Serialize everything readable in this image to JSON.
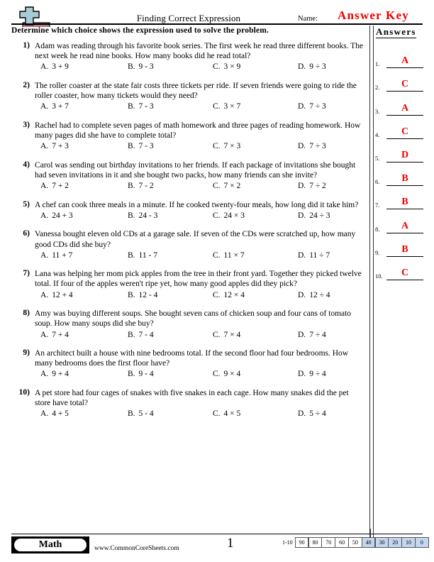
{
  "header": {
    "logo_icon": "plus-block-logo",
    "title": "Finding Correct Expression",
    "name_label": "Name:",
    "answer_key_label": "Answer Key",
    "instructions": "Determine which choice shows the expression used to solve the problem."
  },
  "answers_panel": {
    "heading": "Answers",
    "rows": [
      {
        "num": "1.",
        "value": "A"
      },
      {
        "num": "2.",
        "value": "C"
      },
      {
        "num": "3.",
        "value": "A"
      },
      {
        "num": "4.",
        "value": "C"
      },
      {
        "num": "5.",
        "value": "D"
      },
      {
        "num": "6.",
        "value": "B"
      },
      {
        "num": "7.",
        "value": "B"
      },
      {
        "num": "8.",
        "value": "A"
      },
      {
        "num": "9.",
        "value": "B"
      },
      {
        "num": "10.",
        "value": "C"
      }
    ],
    "answer_color": "#ee0000"
  },
  "questions": [
    {
      "num": "1)",
      "text": "Adam was reading through his favorite book series. The first week he read three different books. The next week he read nine books. How many books did he read total?",
      "options": [
        {
          "letter": "A.",
          "expr": "3 + 9"
        },
        {
          "letter": "B.",
          "expr": "9 - 3"
        },
        {
          "letter": "C.",
          "expr": "3 × 9"
        },
        {
          "letter": "D.",
          "expr": "9 ÷ 3"
        }
      ]
    },
    {
      "num": "2)",
      "text": "The roller coaster at the state fair costs three tickets per ride. If seven friends were going to ride the roller coaster, how many tickets would they need?",
      "options": [
        {
          "letter": "A.",
          "expr": "3 + 7"
        },
        {
          "letter": "B.",
          "expr": "7 - 3"
        },
        {
          "letter": "C.",
          "expr": "3 × 7"
        },
        {
          "letter": "D.",
          "expr": "7 ÷ 3"
        }
      ]
    },
    {
      "num": "3)",
      "text": "Rachel had to complete seven pages of math homework and three pages of reading homework. How many pages did she have to complete total?",
      "options": [
        {
          "letter": "A.",
          "expr": "7 + 3"
        },
        {
          "letter": "B.",
          "expr": "7 - 3"
        },
        {
          "letter": "C.",
          "expr": "7 × 3"
        },
        {
          "letter": "D.",
          "expr": "7 ÷ 3"
        }
      ]
    },
    {
      "num": "4)",
      "text": "Carol was sending out birthday invitations to her friends. If each package of invitations she bought had seven invitations in it and she bought two packs, how many friends can she invite?",
      "options": [
        {
          "letter": "A.",
          "expr": "7 + 2"
        },
        {
          "letter": "B.",
          "expr": "7 - 2"
        },
        {
          "letter": "C.",
          "expr": "7 × 2"
        },
        {
          "letter": "D.",
          "expr": "7 ÷ 2"
        }
      ]
    },
    {
      "num": "5)",
      "text": "A chef can cook three meals in a minute. If he cooked twenty-four meals, how long did it take him?",
      "options": [
        {
          "letter": "A.",
          "expr": "24 + 3"
        },
        {
          "letter": "B.",
          "expr": "24 - 3"
        },
        {
          "letter": "C.",
          "expr": "24 × 3"
        },
        {
          "letter": "D.",
          "expr": "24 ÷ 3"
        }
      ]
    },
    {
      "num": "6)",
      "text": "Vanessa bought eleven old CDs at a garage sale. If seven of the CDs were scratched up, how many good CDs did she buy?",
      "options": [
        {
          "letter": "A.",
          "expr": "11 + 7"
        },
        {
          "letter": "B.",
          "expr": "11 - 7"
        },
        {
          "letter": "C.",
          "expr": "11 × 7"
        },
        {
          "letter": "D.",
          "expr": "11 ÷ 7"
        }
      ]
    },
    {
      "num": "7)",
      "text": "Lana was helping her mom pick apples from the tree in their front yard. Together they picked twelve total. If four of the apples weren't ripe yet, how many good apples did they pick?",
      "options": [
        {
          "letter": "A.",
          "expr": "12 + 4"
        },
        {
          "letter": "B.",
          "expr": "12 - 4"
        },
        {
          "letter": "C.",
          "expr": "12 × 4"
        },
        {
          "letter": "D.",
          "expr": "12 ÷ 4"
        }
      ]
    },
    {
      "num": "8)",
      "text": "Amy was buying different soups. She bought seven cans of chicken soup and four cans of tomato soup. How many soups did she buy?",
      "options": [
        {
          "letter": "A.",
          "expr": "7 + 4"
        },
        {
          "letter": "B.",
          "expr": "7 - 4"
        },
        {
          "letter": "C.",
          "expr": "7 × 4"
        },
        {
          "letter": "D.",
          "expr": "7 ÷ 4"
        }
      ]
    },
    {
      "num": "9)",
      "text": "An architect built a house with nine bedrooms total. If the second floor had four bedrooms. How many bedrooms does the first floor have?",
      "options": [
        {
          "letter": "A.",
          "expr": "9 + 4"
        },
        {
          "letter": "B.",
          "expr": "9 - 4"
        },
        {
          "letter": "C.",
          "expr": "9 × 4"
        },
        {
          "letter": "D.",
          "expr": "9 ÷ 4"
        }
      ]
    },
    {
      "num": "10)",
      "text": "A pet store had four cages of snakes with five snakes in each cage. How many snakes did the pet store have total?",
      "options": [
        {
          "letter": "A.",
          "expr": "4 + 5"
        },
        {
          "letter": "B.",
          "expr": "5 - 4"
        },
        {
          "letter": "C.",
          "expr": "4 × 5"
        },
        {
          "letter": "D.",
          "expr": "5 ÷ 4"
        }
      ]
    }
  ],
  "footer": {
    "subject_label": "Math",
    "site_url": "www.CommonCoreSheets.com",
    "page_number": "1",
    "scale_label": "1-10",
    "scale_cells": [
      {
        "value": "90",
        "highlighted": false
      },
      {
        "value": "80",
        "highlighted": false
      },
      {
        "value": "70",
        "highlighted": false
      },
      {
        "value": "60",
        "highlighted": false
      },
      {
        "value": "50",
        "highlighted": false
      },
      {
        "value": "40",
        "highlighted": true
      },
      {
        "value": "30",
        "highlighted": true
      },
      {
        "value": "20",
        "highlighted": true
      },
      {
        "value": "10",
        "highlighted": true
      },
      {
        "value": "0",
        "highlighted": true
      }
    ],
    "highlight_color": "#c3d7f0"
  }
}
